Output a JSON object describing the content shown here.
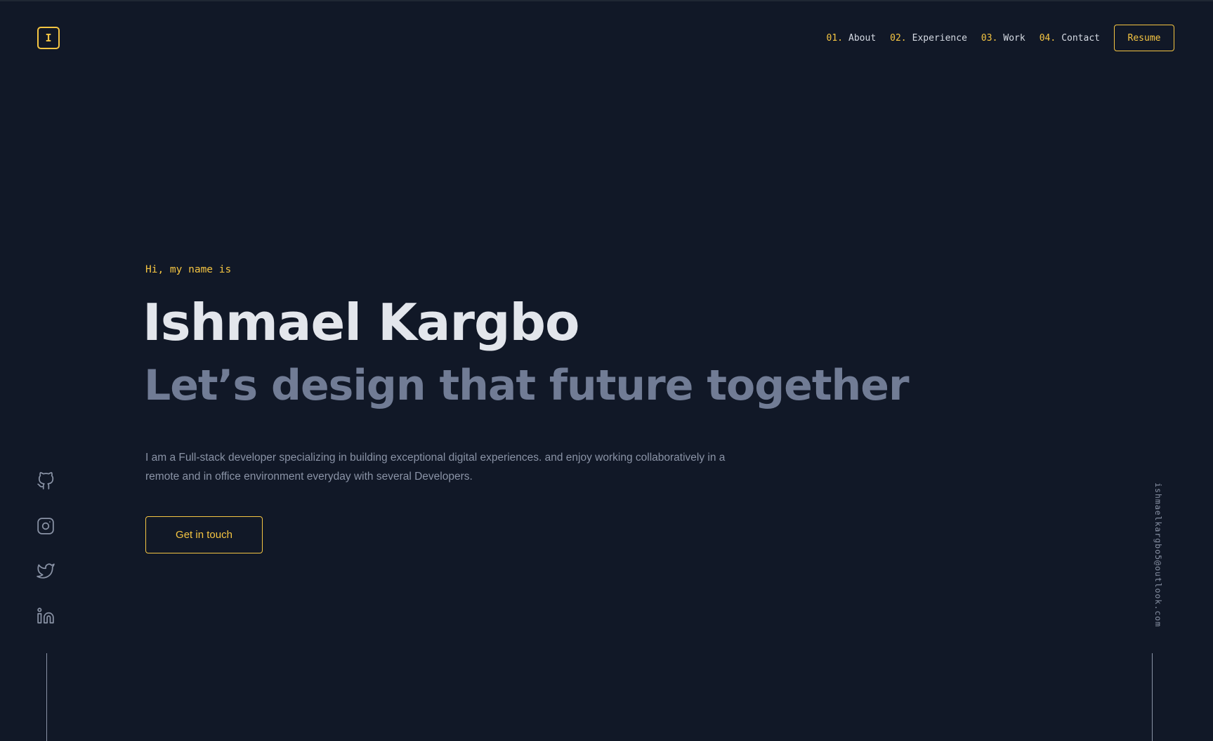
{
  "header": {
    "logo_letter": "I",
    "nav": [
      {
        "num": "01.",
        "label": "About"
      },
      {
        "num": "02.",
        "label": "Experience"
      },
      {
        "num": "03.",
        "label": "Work"
      },
      {
        "num": "04.",
        "label": "Contact"
      }
    ],
    "resume_label": "Resume"
  },
  "hero": {
    "greeting": "Hi, my name is",
    "name": "Ishmael Kargbo",
    "tagline": "Let’s design that future together",
    "bio": "I am a Full-stack developer specializing in building exceptional digital experiences. and enjoy working collaboratively in a remote and in office environment everyday with several Developers.",
    "cta_label": "Get in touch"
  },
  "socials": [
    {
      "icon": "github-icon"
    },
    {
      "icon": "instagram-icon"
    },
    {
      "icon": "twitter-icon"
    },
    {
      "icon": "linkedin-icon"
    }
  ],
  "email": "ishmaelkargbo5@outlook.com",
  "colors": {
    "background": "#111827",
    "accent": "#f5c542",
    "heading": "#e3e6ec",
    "subheading": "#717c95",
    "body_text": "#8a93a6"
  }
}
